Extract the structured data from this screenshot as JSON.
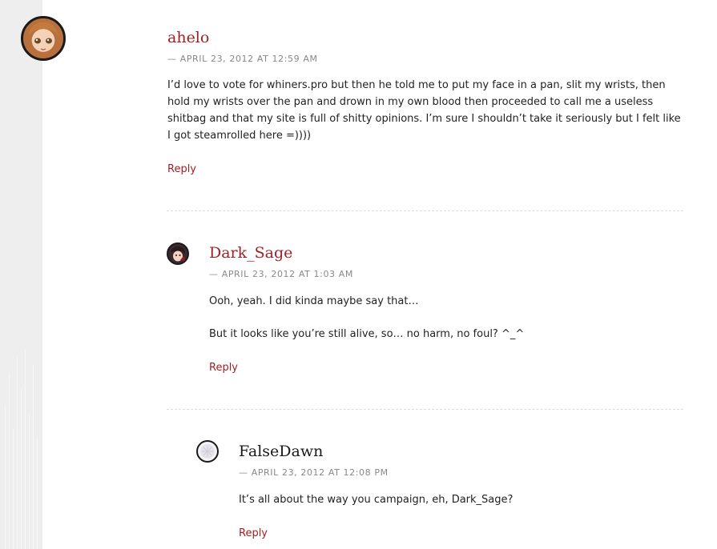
{
  "comments": [
    {
      "author": "ahelo",
      "date": "— April 23, 2012 at 12:59 am",
      "paragraphs": [
        "I’d love to vote for whiners.pro but then he told me to put my face in a pan, slit my wrists, then hold my wrists over the pan and drown in my own blood then proceeded to call me a useless shitbag and that my site is full of shitty opinions. I’m sure I shouldn’t take it seriously but I felt like I got steamrolled here =))))"
      ],
      "reply_label": "Reply"
    },
    {
      "author": "Dark_Sage",
      "date": "— April 23, 2012 at 1:03 am",
      "paragraphs": [
        "Ooh, yeah. I did kinda maybe say that…",
        "But it looks like you’re still alive, so… no harm, no foul? ^_^"
      ],
      "reply_label": "Reply"
    },
    {
      "author": "FalseDawn",
      "date": "— April 23, 2012 at 12:08 pm",
      "paragraphs": [
        "It’s all about the way you campaign, eh, Dark_Sage?"
      ],
      "reply_label": "Reply"
    }
  ],
  "colors": {
    "link": "#a31f23",
    "meta": "#888888",
    "sidebar": "#eeeeee"
  }
}
